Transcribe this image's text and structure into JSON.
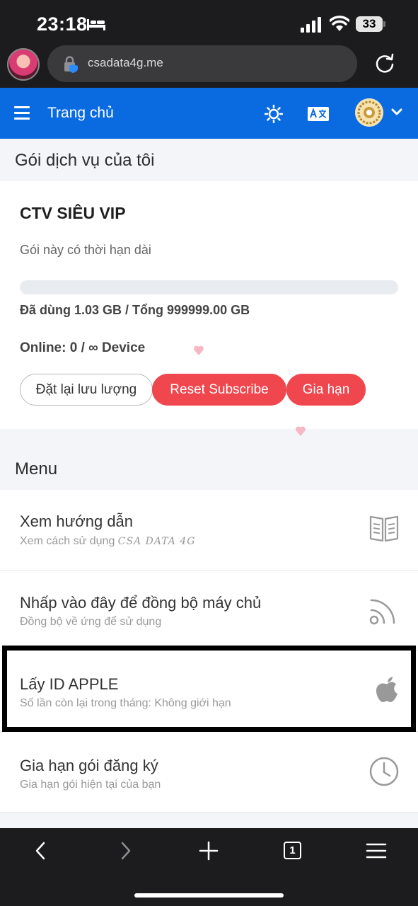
{
  "status_bar": {
    "time": "23:18",
    "battery": "33"
  },
  "browser": {
    "url": "csadata4g.me",
    "tab_count": "1"
  },
  "header": {
    "title": "Trang chủ"
  },
  "service": {
    "section_title": "Gói dịch vụ của tôi",
    "package_name": "CTV SIÊU VIP",
    "description": "Gói này có thời hạn dài",
    "usage_fraction": 1.03e-06,
    "usage_text": "Đã dùng 1.03 GB / Tổng 999999.00 GB",
    "online_text": "Online: 0 / ∞ Device",
    "buttons": {
      "reset_traffic": "Đặt lại lưu lượng",
      "reset_subscribe": "Reset Subscribe",
      "renew": "Gia hạn"
    }
  },
  "menu": {
    "section_title": "Menu",
    "items": [
      {
        "title": "Xem hướng dẫn",
        "subtitle": "Xem cách sử dụng",
        "subtitle_brand": "CSA DATA 4G",
        "icon": "book-icon"
      },
      {
        "title": "Nhấp vào đây để đồng bộ máy chủ",
        "subtitle": "Đồng bộ về ứng để sử dụng",
        "icon": "rss-icon"
      },
      {
        "title": "Lấy ID APPLE",
        "subtitle": "Số lần còn lại trong tháng: Không giới hạn",
        "icon": "apple-icon"
      },
      {
        "title": "Gia hạn gói đăng ký",
        "subtitle": "Gia hạn gói hiện tại của bạn",
        "icon": "clock-icon"
      }
    ]
  },
  "colors": {
    "primary": "#0a6be0",
    "danger": "#f0474f",
    "highlight_border": "#000000"
  }
}
